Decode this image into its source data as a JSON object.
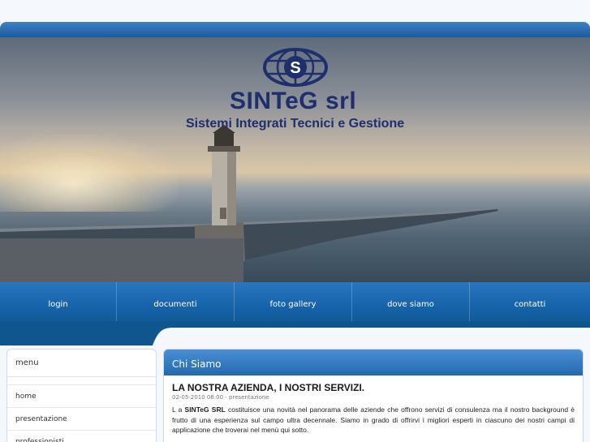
{
  "brand": {
    "name": "SINTeG srl",
    "tagline": "Sistemi Integrati Tecnici e Gestione",
    "logo_icon": "globe-s-logo-icon",
    "color": "#1e2f6e"
  },
  "nav": {
    "items": [
      {
        "label": "login"
      },
      {
        "label": "documenti"
      },
      {
        "label": "foto gallery"
      },
      {
        "label": "dove siamo"
      },
      {
        "label": "contatti"
      }
    ],
    "color": "#1663aa"
  },
  "sidebar": {
    "title": "menu",
    "items": [
      {
        "label": "home"
      },
      {
        "label": "presentazione"
      },
      {
        "label": "professionisti"
      }
    ]
  },
  "content": {
    "section_title": "Chi Siamo",
    "article": {
      "title": "LA NOSTRA AZIENDA, I NOSTRI SERVIZI.",
      "meta": "02-05-2010 08:00 - presentazione",
      "body_prefix": "L a ",
      "body_strong": "SINTeG SRL",
      "body_rest": " costituisce una novità nel panorama delle aziende che offrono servizi di consulenza ma il nostro background è frutto di una esperienza sul campo ultra decennale. Siamo in grado di offrirvi i migliori esperti in ciascuno dei nostri campi di applicazione che troverai nel menù qui sotto."
    },
    "header_color": "#2a74bd"
  }
}
